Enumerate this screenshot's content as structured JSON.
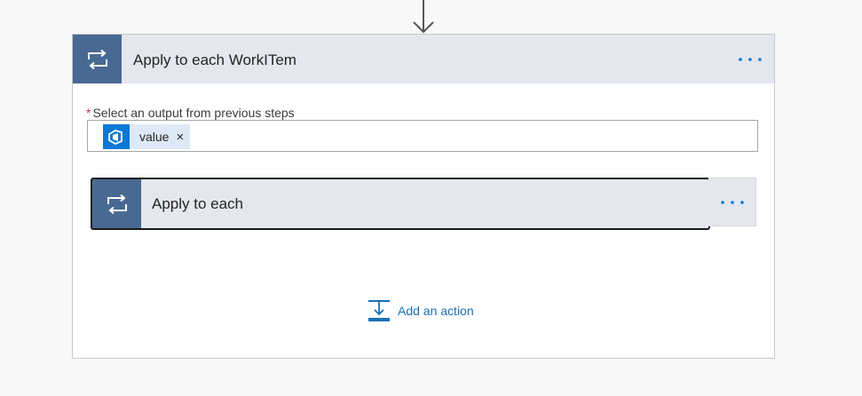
{
  "outer_action": {
    "title": "Apply to each WorkITem",
    "icon": "loop-icon",
    "more_icon": "ellipsis-icon"
  },
  "field": {
    "required_marker": "*",
    "label": "Select an output from previous steps",
    "token": {
      "icon": "azure-devops-icon",
      "label": "value",
      "close_glyph": "×"
    }
  },
  "inner_action": {
    "title": "Apply to each",
    "icon": "loop-icon",
    "more_icon": "ellipsis-icon"
  },
  "add_action": {
    "label": "Add an action",
    "icon": "add-action-icon"
  },
  "colors": {
    "icon_background": "#486991",
    "header_background": "#e4e7ee",
    "accent_blue": "#0a78d4",
    "link_blue": "#1a6fb5",
    "required_red": "#c4314b",
    "token_background": "#dde9f6"
  }
}
